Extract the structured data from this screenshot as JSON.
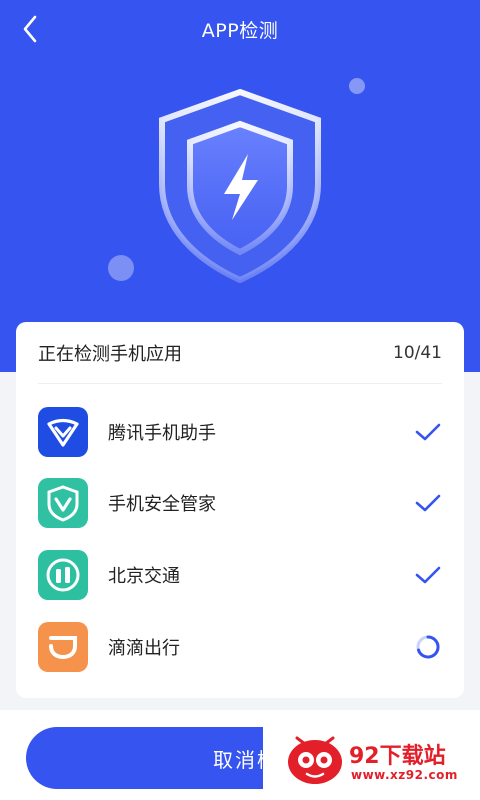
{
  "header": {
    "title": "APP检测",
    "back_icon": "chevron-left-icon"
  },
  "colors": {
    "primary": "#3554f0",
    "check": "#3554f0",
    "background": "#f3f4f8"
  },
  "scan_card": {
    "label": "正在检测手机应用",
    "progress_text": "10/41",
    "progress": {
      "done": 10,
      "total": 41
    }
  },
  "apps": [
    {
      "name": "腾讯手机助手",
      "icon": "tencent-assistant-icon",
      "status": "done"
    },
    {
      "name": "手机安全管家",
      "icon": "security-manager-icon",
      "status": "done"
    },
    {
      "name": "北京交通",
      "icon": "beijing-transport-icon",
      "status": "done"
    },
    {
      "name": "滴滴出行",
      "icon": "didi-icon",
      "status": "scanning"
    }
  ],
  "footer": {
    "cancel_label": "取消检"
  },
  "watermark": {
    "title": "92下载站",
    "url": "www.xz92.com"
  }
}
